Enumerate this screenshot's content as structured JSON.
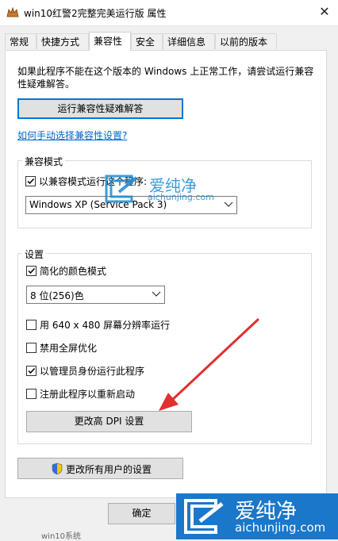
{
  "window": {
    "title": "win10红警2完整完美运行版 属性",
    "close_symbol": "✕"
  },
  "tabs": [
    "常规",
    "快捷方式",
    "兼容性",
    "安全",
    "详细信息",
    "以前的版本"
  ],
  "active_tab": "兼容性",
  "intro_text": "如果此程序不能在这个版本的 Windows 上正常工作，请尝试运行兼容性疑难解答。",
  "troubleshoot_button": "运行兼容性疑难解答",
  "manual_link": "如何手动选择兼容性设置?",
  "compat_mode": {
    "group_label": "兼容模式",
    "checkbox_label": "以兼容模式运行这个程序:",
    "checked": true,
    "selected_os": "Windows XP (Service Pack 3)"
  },
  "settings": {
    "group_label": "设置",
    "reduced_color_label": "简化的颜色模式",
    "reduced_color_checked": true,
    "color_depth": "8 位(256)色",
    "options": [
      {
        "label": "用 640 x 480 屏幕分辨率运行",
        "checked": false
      },
      {
        "label": "禁用全屏优化",
        "checked": false
      },
      {
        "label": "以管理员身份运行此程序",
        "checked": true
      },
      {
        "label": "注册此程序以重新启动",
        "checked": false
      }
    ],
    "dpi_button": "更改高 DPI 设置"
  },
  "all_users_button": "更改所有用户的设置",
  "ok_button": "确定",
  "status_text": "win10系统",
  "watermark": {
    "brand": "爱纯净",
    "url": "aichunjing.com"
  },
  "colors": {
    "accent": "#0078d7",
    "link": "#0066cc",
    "arrow": "#e03030",
    "watermark": "#1a77c9"
  }
}
